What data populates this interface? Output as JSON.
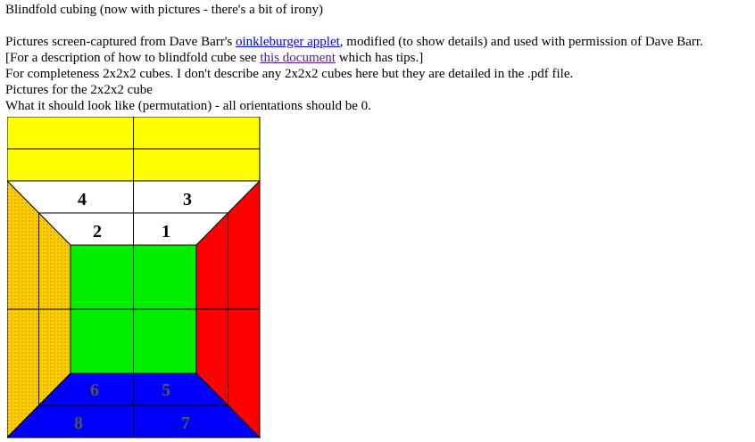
{
  "page": {
    "title": "Blindfold cubing (now with pictures - there's a bit of irony)",
    "credit": {
      "before": "Pictures screen-captured from Dave Barr's ",
      "link": "oinkleburger applet",
      "after": ", modified (to show details) and used with permission of Dave Barr."
    },
    "description": {
      "before": "[For a description of how to blindfold cube see ",
      "link": "this document",
      "after": " which has tips.]"
    },
    "completeness": "For completeness 2x2x2 cubes. I don't describe any 2x2x2 cubes here but they are detailed in the .pdf file.",
    "pictures_heading": "Pictures for the 2x2x2 cube",
    "caption": "What it should look like (permutation) - all orientations should be 0."
  },
  "cube_diagram": {
    "colors": {
      "top": "#ffff00",
      "back": "#ffffff",
      "left": "#ffcc00",
      "right": "#ff0000",
      "front": "#00ee00",
      "bottom": "#0000ff",
      "outline": "#000000"
    },
    "labels": [
      "4",
      "3",
      "2",
      "1",
      "6",
      "5",
      "8",
      "7"
    ]
  }
}
